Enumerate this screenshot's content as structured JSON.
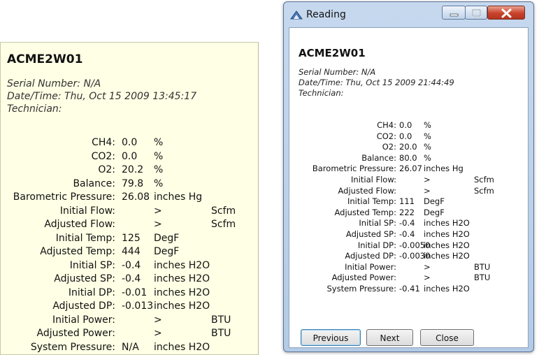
{
  "tooltip": {
    "station": "ACME2W01",
    "serial": "Serial Number: N/A",
    "datetime": "Date/Time: Thu, Oct 15 2009 13:45:17",
    "technician": "Technician:",
    "rows": [
      {
        "label": "CH4:",
        "value": "0.0",
        "unit": "%",
        "extra": ""
      },
      {
        "label": "CO2:",
        "value": "0.0",
        "unit": "%",
        "extra": ""
      },
      {
        "label": "O2:",
        "value": "20.2",
        "unit": "%",
        "extra": ""
      },
      {
        "label": "Balance:",
        "value": "79.8",
        "unit": "%",
        "extra": ""
      },
      {
        "label": "Barometric Pressure:",
        "value": "26.08",
        "unit": "inches Hg",
        "extra": ""
      },
      {
        "label": "Initial Flow:",
        "value": "",
        "unit": ">",
        "extra": "Scfm"
      },
      {
        "label": "Adjusted Flow:",
        "value": "",
        "unit": ">",
        "extra": "Scfm"
      },
      {
        "label": "Initial Temp:",
        "value": "125",
        "unit": "DegF",
        "extra": ""
      },
      {
        "label": "Adjusted Temp:",
        "value": "444",
        "unit": "DegF",
        "extra": ""
      },
      {
        "label": "Initial SP:",
        "value": "-0.4",
        "unit": "inches H2O",
        "extra": ""
      },
      {
        "label": "Adjusted SP:",
        "value": "-0.4",
        "unit": "inches H2O",
        "extra": ""
      },
      {
        "label": "Initial DP:",
        "value": "-0.01",
        "unit": "inches H2O",
        "extra": ""
      },
      {
        "label": "Adjusted DP:",
        "value": "-0.013",
        "unit": "inches H2O",
        "extra": ""
      },
      {
        "label": "Initial Power:",
        "value": "",
        "unit": ">",
        "extra": "BTU"
      },
      {
        "label": "Adjusted Power:",
        "value": "",
        "unit": ">",
        "extra": "BTU"
      },
      {
        "label": "System Pressure:",
        "value": "N/A",
        "unit": "inches H2O",
        "extra": ""
      }
    ]
  },
  "window": {
    "title": "Reading",
    "station": "ACME2W01",
    "serial": "Serial Number: N/A",
    "datetime": "Date/Time: Thu, Oct 15 2009 21:44:49",
    "technician": "Technician:",
    "rows": [
      {
        "label": "CH4:",
        "value": "0.0",
        "unit": "%",
        "extra": ""
      },
      {
        "label": "CO2:",
        "value": "0.0",
        "unit": "%",
        "extra": ""
      },
      {
        "label": "O2:",
        "value": "20.0",
        "unit": "%",
        "extra": ""
      },
      {
        "label": "Balance:",
        "value": "80.0",
        "unit": "%",
        "extra": ""
      },
      {
        "label": "Barometric Pressure:",
        "value": "26.07",
        "unit": "inches Hg",
        "extra": ""
      },
      {
        "label": "Initial Flow:",
        "value": "",
        "unit": ">",
        "extra": "Scfm"
      },
      {
        "label": "Adjusted Flow:",
        "value": "",
        "unit": ">",
        "extra": "Scfm"
      },
      {
        "label": "Initial Temp:",
        "value": "111",
        "unit": "DegF",
        "extra": ""
      },
      {
        "label": "Adjusted Temp:",
        "value": "222",
        "unit": "DegF",
        "extra": ""
      },
      {
        "label": "Initial SP:",
        "value": "-0.4",
        "unit": "inches H2O",
        "extra": ""
      },
      {
        "label": "Adjusted SP:",
        "value": "-0.4",
        "unit": "inches H2O",
        "extra": ""
      },
      {
        "label": "Initial DP:",
        "value": "-0.0050",
        "unit": "inches H2O",
        "extra": ""
      },
      {
        "label": "Adjusted DP:",
        "value": "-0.0030",
        "unit": "inches H2O",
        "extra": ""
      },
      {
        "label": "Initial Power:",
        "value": "",
        "unit": ">",
        "extra": "BTU"
      },
      {
        "label": "Adjusted Power:",
        "value": "",
        "unit": ">",
        "extra": "BTU"
      },
      {
        "label": "System Pressure:",
        "value": "-0.41",
        "unit": "inches H2O",
        "extra": ""
      }
    ],
    "buttons": {
      "previous": "Previous",
      "next": "Next",
      "close": "Close"
    }
  }
}
